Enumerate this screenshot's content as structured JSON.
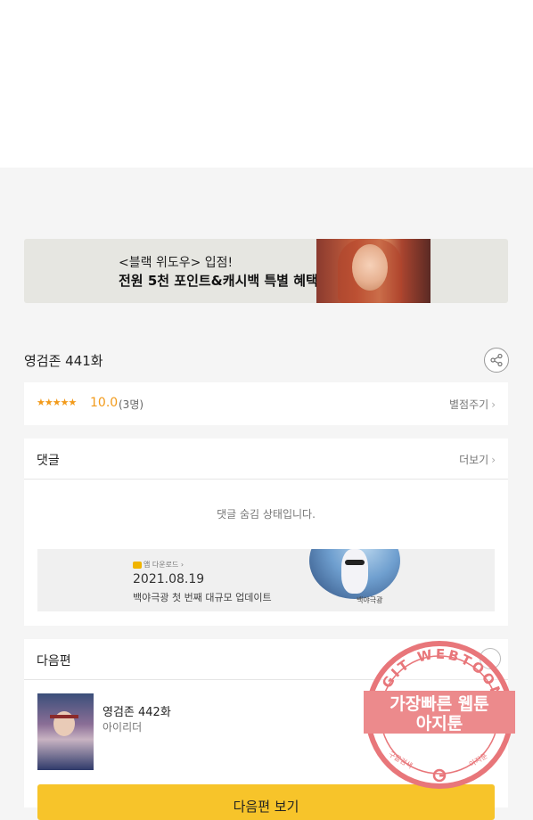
{
  "banner": {
    "line1": "<블랙 위도우> 입점!",
    "line2": "전원 5천 포인트&캐시백 특별 혜택"
  },
  "episode": {
    "title": "영검존 441화"
  },
  "rating": {
    "stars": "★★★★★",
    "score": "10.0",
    "count": "(3명)",
    "rate_link": "별점주기"
  },
  "comments": {
    "label": "댓글",
    "more": "더보기",
    "hidden_message": "댓글 숨김 상태입니다."
  },
  "ad": {
    "small_label": "앱 다운로드",
    "date": "2021.08.19",
    "description": "백야극광 첫 번째 대규모 업데이트",
    "signature": "백야극광"
  },
  "next": {
    "label": "다음편",
    "episode_title": "영검존 442화",
    "author": "아이리더",
    "button": "다음편 보기"
  },
  "watermark": {
    "arc_text": "AGIT WEBTOON",
    "line1": "가장빠른 웹툰",
    "line2": "아지툰",
    "bottom_left": "구글검색",
    "bottom_right": "아지툰"
  },
  "colors": {
    "accent": "#f29a1a",
    "button": "#f7c42a",
    "watermark": "#e8767a"
  }
}
